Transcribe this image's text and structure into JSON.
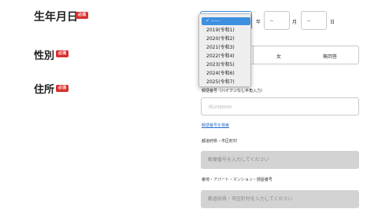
{
  "birthdate": {
    "label": "生年月日",
    "required": "必須",
    "year_unit": "年",
    "month_value": "--",
    "month_unit": "月",
    "day_value": "--",
    "day_unit": "日"
  },
  "year_dropdown": {
    "options": [
      {
        "label": "✓ -----",
        "selected": true
      },
      {
        "label": "2019(令和1)"
      },
      {
        "label": "2020(令和2)"
      },
      {
        "label": "2021(令和3)"
      },
      {
        "label": "2022(令和4)"
      },
      {
        "label": "2023(令和5)"
      },
      {
        "label": "2024(令和6)"
      },
      {
        "label": "2025(令和7)"
      }
    ]
  },
  "gender": {
    "label": "性別",
    "required": "必須",
    "options": [
      "女",
      "無回答"
    ]
  },
  "address": {
    "label": "住所",
    "required": "必須",
    "postal_label": "郵便番号（ハイフンなし半角入力）",
    "postal_placeholder": "例)2580000",
    "search_link": "郵便番号を検索",
    "pref_label": "都道府県・市区町村",
    "pref_placeholder": "郵便番号を入力してください",
    "street_label": "番地・アパート・マンション・部屋番号",
    "street_placeholder": "都道府県・市区町村を入力してください"
  },
  "colors": {
    "badge": "#d9302c",
    "selection": "#3d8fe0",
    "link": "#2f6fd0"
  }
}
